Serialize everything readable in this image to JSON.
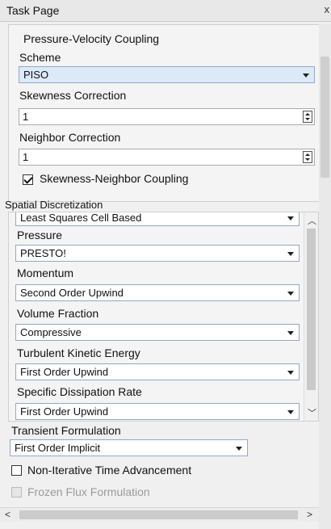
{
  "window": {
    "title": "Task Page"
  },
  "pressure_velocity": {
    "group_label": "Pressure-Velocity Coupling",
    "scheme_label": "Scheme",
    "scheme_value": "PISO",
    "skewness_label": "Skewness Correction",
    "skewness_value": "1",
    "neighbor_label": "Neighbor Correction",
    "neighbor_value": "1",
    "coupling_label": "Skewness-Neighbor Coupling",
    "coupling_checked": true
  },
  "spatial": {
    "group_label": "Spatial Discretization",
    "gradient_value": "Least Squares Cell Based",
    "fields": [
      {
        "label": "Pressure",
        "value": "PRESTO!"
      },
      {
        "label": "Momentum",
        "value": "Second Order Upwind"
      },
      {
        "label": "Volume Fraction",
        "value": "Compressive"
      },
      {
        "label": "Turbulent Kinetic Energy",
        "value": "First Order Upwind"
      },
      {
        "label": "Specific Dissipation Rate",
        "value": "First Order Upwind"
      }
    ]
  },
  "transient": {
    "label": "Transient Formulation",
    "value": "First Order Implicit",
    "non_iterative_label": "Non-Iterative Time Advancement",
    "non_iterative_checked": false,
    "frozen_flux_label": "Frozen Flux Formulation",
    "frozen_flux_enabled": false
  },
  "icons": {
    "close": "close-icon",
    "dropdown": "chevron-down-icon",
    "spin": "spinner-icon",
    "scroll_up": "chevron-up-icon",
    "scroll_down": "chevron-down-icon",
    "scroll_left": "chevron-left-icon",
    "scroll_right": "chevron-right-icon"
  },
  "colors": {
    "selected_combo": "#dce9f7",
    "combo_border": "#8fa9c8",
    "panel_bg": "#f0f0f0"
  }
}
